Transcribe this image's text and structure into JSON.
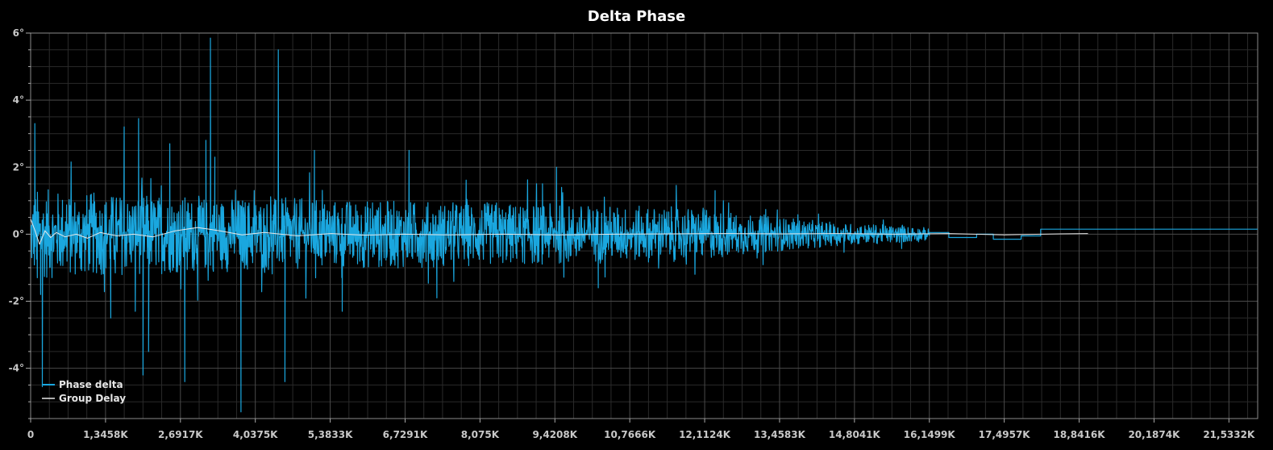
{
  "chart_data": {
    "type": "line",
    "title": "Delta Phase",
    "xlabel": "",
    "ylabel": "",
    "xlim": [
      0,
      22050
    ],
    "ylim": [
      -5.5,
      6.0
    ],
    "grid": true,
    "legend_position": "bottom-left",
    "x_ticks": [
      {
        "value": 0,
        "label": "0"
      },
      {
        "value": 1345.8,
        "label": "1,3458K"
      },
      {
        "value": 2691.7,
        "label": "2,6917K"
      },
      {
        "value": 4037.5,
        "label": "4,0375K"
      },
      {
        "value": 5383.3,
        "label": "5,3833K"
      },
      {
        "value": 6729.1,
        "label": "6,7291K"
      },
      {
        "value": 8075.0,
        "label": "8,075K"
      },
      {
        "value": 9420.8,
        "label": "9,4208K"
      },
      {
        "value": 10766.6,
        "label": "10,7666K"
      },
      {
        "value": 12112.4,
        "label": "12,1124K"
      },
      {
        "value": 13458.3,
        "label": "13,4583K"
      },
      {
        "value": 14804.1,
        "label": "14,8041K"
      },
      {
        "value": 16149.9,
        "label": "16,1499K"
      },
      {
        "value": 17495.7,
        "label": "17,4957K"
      },
      {
        "value": 18841.6,
        "label": "18,8416K"
      },
      {
        "value": 20187.4,
        "label": "20,1874K"
      },
      {
        "value": 21533.2,
        "label": "21,5332K"
      }
    ],
    "y_ticks": [
      {
        "value": 6,
        "label": "6°"
      },
      {
        "value": 4,
        "label": "4°"
      },
      {
        "value": 2,
        "label": "2°"
      },
      {
        "value": 0,
        "label": "0°"
      },
      {
        "value": -2,
        "label": "-2°"
      },
      {
        "value": -4,
        "label": "-4°"
      }
    ],
    "series": [
      {
        "name": "Phase delta",
        "color": "#1aa7df",
        "envelope": [
          [
            0,
            1.2
          ],
          [
            1000,
            1.1
          ],
          [
            3000,
            1.0
          ],
          [
            6000,
            0.9
          ],
          [
            9000,
            0.8
          ],
          [
            12000,
            0.7
          ],
          [
            13000,
            0.5
          ],
          [
            14500,
            0.3
          ],
          [
            16000,
            0.2
          ],
          [
            16200,
            0.12
          ],
          [
            22050,
            0.08
          ]
        ],
        "spikes": [
          {
            "x": 75,
            "y": 3.3
          },
          {
            "x": 120,
            "y": -1.3
          },
          {
            "x": 180,
            "y": -1.8
          },
          {
            "x": 210,
            "y": -4.55
          },
          {
            "x": 1440,
            "y": -2.5
          },
          {
            "x": 1680,
            "y": 3.2
          },
          {
            "x": 1880,
            "y": -2.3
          },
          {
            "x": 1940,
            "y": 3.45
          },
          {
            "x": 2020,
            "y": -4.2
          },
          {
            "x": 2120,
            "y": -3.5
          },
          {
            "x": 2500,
            "y": 2.7
          },
          {
            "x": 2770,
            "y": -4.4
          },
          {
            "x": 3150,
            "y": 2.8
          },
          {
            "x": 3230,
            "y": 5.85
          },
          {
            "x": 3310,
            "y": 2.3
          },
          {
            "x": 3780,
            "y": -5.3
          },
          {
            "x": 4450,
            "y": 5.5
          },
          {
            "x": 4570,
            "y": -4.4
          },
          {
            "x": 5100,
            "y": 2.5
          },
          {
            "x": 5600,
            "y": -2.3
          },
          {
            "x": 6800,
            "y": 2.5
          },
          {
            "x": 7300,
            "y": -1.9
          },
          {
            "x": 9450,
            "y": 2.0
          },
          {
            "x": 10200,
            "y": -1.6
          },
          {
            "x": 12300,
            "y": 1.3
          }
        ],
        "steps": [
          {
            "x": 16150,
            "y": 0.05
          },
          {
            "x": 16500,
            "y": -0.1
          },
          {
            "x": 17000,
            "y": 0.0
          },
          {
            "x": 17300,
            "y": -0.15
          },
          {
            "x": 17800,
            "y": -0.05
          },
          {
            "x": 18150,
            "y": 0.15
          },
          {
            "x": 22050,
            "y": 0.15
          }
        ]
      },
      {
        "name": "Group Delay",
        "color": "#e8e8e8",
        "values": [
          [
            0,
            0.45
          ],
          [
            80,
            0.1
          ],
          [
            160,
            -0.3
          ],
          [
            260,
            0.1
          ],
          [
            360,
            -0.1
          ],
          [
            460,
            0.05
          ],
          [
            620,
            -0.08
          ],
          [
            820,
            0.0
          ],
          [
            1020,
            -0.12
          ],
          [
            1250,
            0.05
          ],
          [
            1550,
            -0.05
          ],
          [
            1850,
            0.0
          ],
          [
            2200,
            -0.08
          ],
          [
            2600,
            0.1
          ],
          [
            3000,
            0.2
          ],
          [
            3400,
            0.1
          ],
          [
            3800,
            -0.02
          ],
          [
            4200,
            0.05
          ],
          [
            4800,
            -0.05
          ],
          [
            5400,
            0.02
          ],
          [
            6000,
            -0.03
          ],
          [
            6700,
            0.0
          ],
          [
            7500,
            -0.02
          ],
          [
            8500,
            0.0
          ],
          [
            9500,
            -0.02
          ],
          [
            10500,
            0.0
          ],
          [
            11500,
            0.01
          ],
          [
            12500,
            0.02
          ],
          [
            13500,
            0.01
          ],
          [
            14500,
            0.02
          ],
          [
            15500,
            0.0
          ],
          [
            16500,
            0.02
          ],
          [
            17500,
            -0.02
          ],
          [
            18500,
            0.01
          ],
          [
            19000,
            0.02
          ]
        ]
      }
    ]
  }
}
